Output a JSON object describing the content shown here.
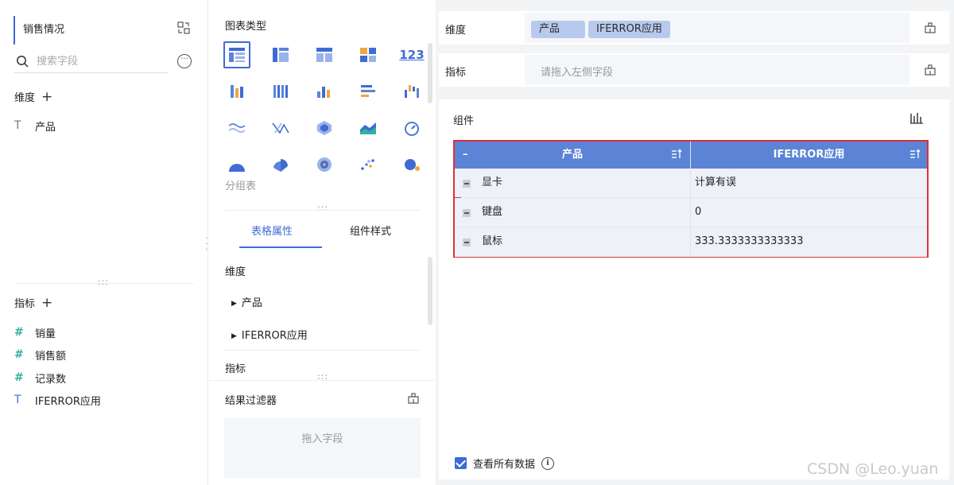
{
  "left": {
    "dataset_title": "销售情况",
    "search_placeholder": "搜索字段",
    "more_label": "···",
    "dimension_header": "维度",
    "measure_header": "指标",
    "plus": "+",
    "dimension_fields": [
      {
        "icon_text": "T",
        "label": "产品"
      }
    ],
    "measure_fields": [
      {
        "icon_text": "#",
        "label": "销量"
      },
      {
        "icon_text": "#",
        "label": "销售额"
      },
      {
        "icon_text": "#",
        "label": "记录数"
      },
      {
        "icon_text": "T",
        "label": "IFERROR应用"
      }
    ]
  },
  "middle": {
    "chart_type_title": "图表类型",
    "selected_chart_label": "分组表",
    "number_chart_glyph": "123",
    "tabs": [
      "表格属性",
      "组件样式"
    ],
    "prop_dimension_header": "维度",
    "prop_dimension_items": [
      "产品",
      "IFERROR应用"
    ],
    "prop_measure_header": "指标",
    "filter_title": "结果过滤器",
    "filter_placeholder": "拖入字段"
  },
  "right": {
    "dimension_shelf_label": "维度",
    "dimension_pills": [
      "产品",
      "IFERROR应用"
    ],
    "measure_shelf_label": "指标",
    "measure_placeholder": "请拖入左侧字段",
    "component_title": "组件",
    "table": {
      "headers": [
        "产品",
        "IFERROR应用"
      ],
      "rows": [
        {
          "product": "显卡",
          "value": "计算有误"
        },
        {
          "product": "键盘",
          "value": "0"
        },
        {
          "product": "鼠标",
          "value": "333.3333333333333"
        }
      ]
    },
    "view_all_label": "查看所有数据",
    "info_glyph": "i"
  },
  "watermark": "CSDN @Leo.yuan",
  "colors": {
    "accent": "#3f6bd6",
    "table_header": "#5b84d6",
    "highlight_border": "#e0303a",
    "pill": "#b8c9ee",
    "measure_icon": "#2fb39b"
  }
}
